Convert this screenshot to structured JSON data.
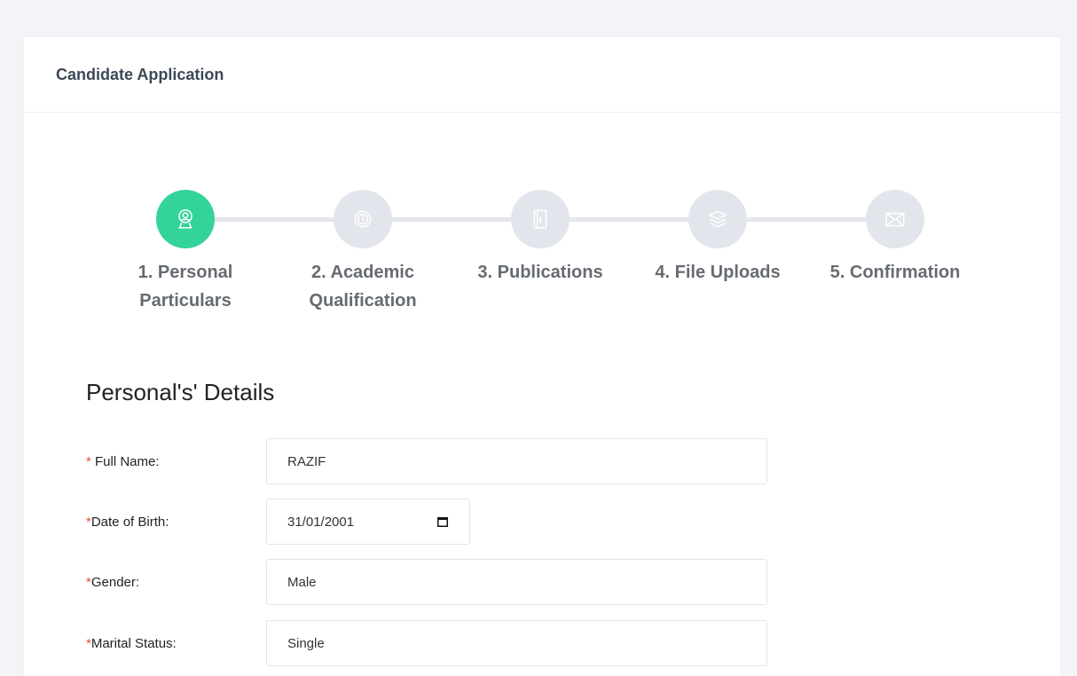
{
  "header": {
    "title": "Candidate Application"
  },
  "wizard": {
    "steps": [
      {
        "label": "1. Personal\nParticulars",
        "icon": "user-icon",
        "active": true
      },
      {
        "label": "2. Academic\nQualification",
        "icon": "badge-icon",
        "active": false
      },
      {
        "label": "3. Publications",
        "icon": "document-icon",
        "active": false
      },
      {
        "label": "4. File Uploads",
        "icon": "layers-icon",
        "active": false
      },
      {
        "label": "5. Confirmation",
        "icon": "envelope-icon",
        "active": false
      }
    ],
    "colors": {
      "active": "#34d39a",
      "inactive": "#e3e5ec"
    }
  },
  "section": {
    "title": "Personal's' Details"
  },
  "form": {
    "required_mark": "*",
    "full_name": {
      "label": " Full Name:",
      "value": "RAZIF"
    },
    "dob": {
      "label": "Date of Birth:",
      "value": "31/01/2001"
    },
    "gender": {
      "label": "Gender:",
      "value": "Male"
    },
    "marital": {
      "label": "Marital Status:",
      "value": "Single"
    }
  }
}
